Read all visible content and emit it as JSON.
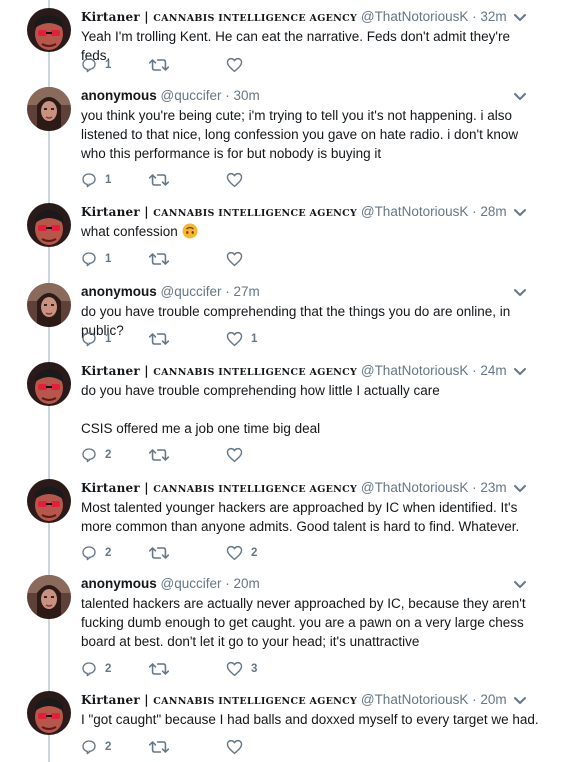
{
  "tweets": [
    {
      "author_kind": "k",
      "name_main": "Kirtaner | ",
      "name_sc": "CANNABIS INTELLIGENCE AGENCY",
      "handle": "@ThatNotoriousK",
      "time": "· 32m",
      "body": "Yeah I'm trolling Kent. He can eat the narrative. Feds don't admit they're feds.",
      "replies": "1",
      "retweets": "",
      "likes": ""
    },
    {
      "author_kind": "a",
      "name_main": "anonymous",
      "name_sc": "",
      "handle": "@quccifer",
      "time": "· 30m",
      "body": "you think you're being cute; i'm trying to tell you it's not happening. i also listened to that nice, long confession you gave on hate radio. i don't know who this performance is for but nobody is buying it",
      "replies": "1",
      "retweets": "",
      "likes": ""
    },
    {
      "author_kind": "k",
      "name_main": "Kirtaner | ",
      "name_sc": "CANNABIS INTELLIGENCE AGENCY",
      "handle": "@ThatNotoriousK",
      "time": "· 28m",
      "body": "what confession",
      "replies": "1",
      "retweets": "",
      "likes": ""
    },
    {
      "author_kind": "a",
      "name_main": "anonymous",
      "name_sc": "",
      "handle": "@quccifer",
      "time": "· 27m",
      "body": "do you have trouble comprehending that the things you do are online, in public?",
      "replies": "1",
      "retweets": "",
      "likes": "1"
    },
    {
      "author_kind": "k",
      "name_main": "Kirtaner | ",
      "name_sc": "CANNABIS INTELLIGENCE AGENCY",
      "handle": "@ThatNotoriousK",
      "time": "· 24m",
      "body": "do you have trouble comprehending how little I actually care\n\nCSIS offered me a job one time big deal",
      "replies": "2",
      "retweets": "",
      "likes": ""
    },
    {
      "author_kind": "k",
      "name_main": "Kirtaner | ",
      "name_sc": "CANNABIS INTELLIGENCE AGENCY",
      "handle": "@ThatNotoriousK",
      "time": "· 23m",
      "body": "Most talented younger hackers are approached by IC when identified. It's more common than anyone admits. Good talent is hard to find. Whatever.",
      "replies": "2",
      "retweets": "",
      "likes": "2"
    },
    {
      "author_kind": "a",
      "name_main": "anonymous",
      "name_sc": "",
      "handle": "@quccifer",
      "time": "· 20m",
      "body": "talented hackers are actually never approached by IC, because they aren't fucking dumb enough to get caught. you are a pawn on a very large chess board at best. don't let it go to your head; it's unattractive",
      "replies": "2",
      "retweets": "",
      "likes": "3"
    },
    {
      "author_kind": "k",
      "name_main": "Kirtaner | ",
      "name_sc": "CANNABIS INTELLIGENCE AGENCY",
      "handle": "@ThatNotoriousK",
      "time": "· 20m",
      "body": "I \"got caught\" because I had balls and doxxed myself to every target we had.",
      "replies": "2",
      "retweets": "",
      "likes": ""
    }
  ]
}
